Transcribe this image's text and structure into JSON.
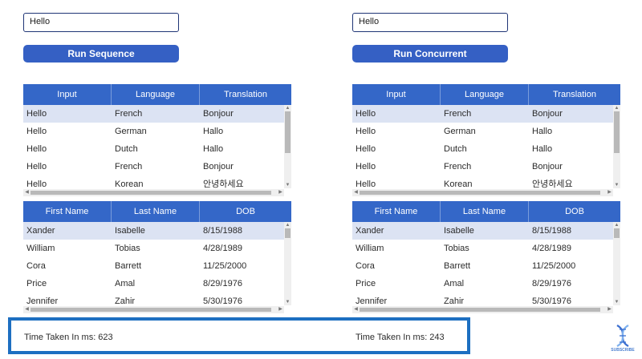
{
  "left": {
    "input_value": "Hello",
    "button_label": "Run Sequence",
    "translations": {
      "headers": [
        "Input",
        "Language",
        "Translation"
      ],
      "rows": [
        [
          "Hello",
          "French",
          "Bonjour"
        ],
        [
          "Hello",
          "German",
          "Hallo"
        ],
        [
          "Hello",
          "Dutch",
          "Hallo"
        ],
        [
          "Hello",
          "French",
          "Bonjour"
        ],
        [
          "Hello",
          "Korean",
          "안녕하세요"
        ]
      ]
    },
    "people": {
      "headers": [
        "First Name",
        "Last Name",
        "DOB"
      ],
      "rows": [
        [
          "Xander",
          "Isabelle",
          "8/15/1988"
        ],
        [
          "William",
          "Tobias",
          "4/28/1989"
        ],
        [
          "Cora",
          "Barrett",
          "11/25/2000"
        ],
        [
          "Price",
          "Amal",
          "8/29/1976"
        ],
        [
          "Jennifer",
          "Zahir",
          "5/30/1976"
        ]
      ]
    },
    "time_label": "Time Taken In ms: 623"
  },
  "right": {
    "input_value": "Hello",
    "button_label": "Run Concurrent",
    "translations": {
      "headers": [
        "Input",
        "Language",
        "Translation"
      ],
      "rows": [
        [
          "Hello",
          "French",
          "Bonjour"
        ],
        [
          "Hello",
          "German",
          "Hallo"
        ],
        [
          "Hello",
          "Dutch",
          "Hallo"
        ],
        [
          "Hello",
          "French",
          "Bonjour"
        ],
        [
          "Hello",
          "Korean",
          "안녕하세요"
        ]
      ]
    },
    "people": {
      "headers": [
        "First Name",
        "Last Name",
        "DOB"
      ],
      "rows": [
        [
          "Xander",
          "Isabelle",
          "8/15/1988"
        ],
        [
          "William",
          "Tobias",
          "4/28/1989"
        ],
        [
          "Cora",
          "Barrett",
          "11/25/2000"
        ],
        [
          "Price",
          "Amal",
          "8/29/1976"
        ],
        [
          "Jennifer",
          "Zahir",
          "5/30/1976"
        ]
      ]
    },
    "time_label": "Time Taken In ms: 243"
  },
  "colors": {
    "header_blue": "#3467c8",
    "button_blue": "#3560c4",
    "highlight_box": "#1d6fc1",
    "selected_row": "#dce3f3"
  },
  "icons": {
    "logo": "dna-logo-icon"
  },
  "logo_text": "SUBSCRIBE"
}
